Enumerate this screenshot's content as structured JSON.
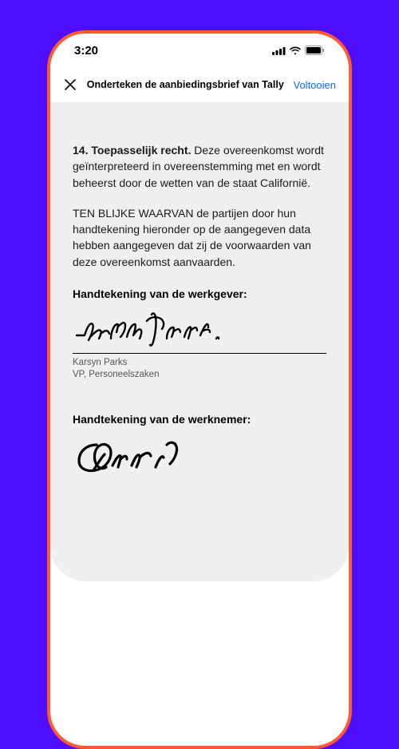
{
  "status": {
    "time": "3:20"
  },
  "nav": {
    "title": "Onderteken de aanbiedingsbrief van Tally",
    "action": "Voltooien"
  },
  "section": {
    "heading": "14. Toepasselijk recht.",
    "body": "Deze overeenkomst wordt geïnterpreteerd in overeenstemming met en wordt beheerst door de wetten van de staat Californië."
  },
  "witness": "TEN BLIJKE WAARVAN de partijen door hun handtekening hieronder op de aangegeven data hebben aangegeven dat zij de voorwaarden van deze overeenkomst aanvaarden.",
  "employer": {
    "label": "Handtekening van de werkgever:",
    "signer_name": "Karsyn Parks",
    "signer_title": "VP, Personeelszaken"
  },
  "employee": {
    "label": "Handtekening van de werknemer:"
  }
}
